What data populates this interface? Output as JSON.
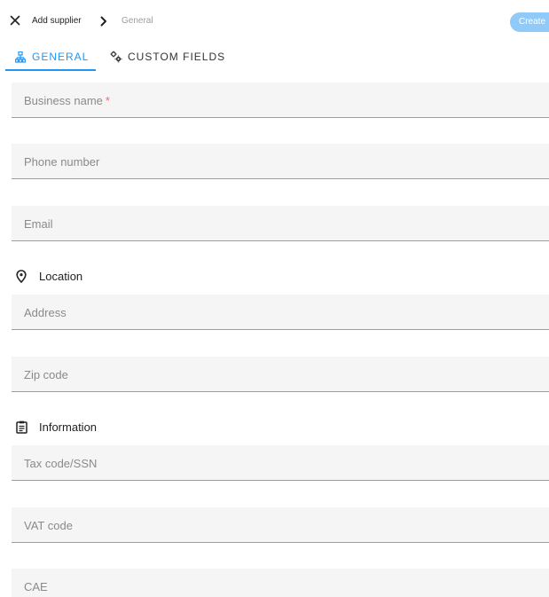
{
  "header": {
    "breadcrumb": [
      "Add supplier",
      "General"
    ],
    "create_label": "Create"
  },
  "tabs": [
    {
      "label": "GENERAL",
      "icon": "sitemap-icon",
      "active": true
    },
    {
      "label": "CUSTOM FIELDS",
      "icon": "cogs-icon",
      "active": false
    }
  ],
  "form": {
    "business_name": {
      "placeholder": "Business name",
      "required_mark": "*"
    },
    "phone_number": {
      "placeholder": "Phone number"
    },
    "email": {
      "placeholder": "Email"
    },
    "location": {
      "title": "Location",
      "icon": "map-pin-icon",
      "address": {
        "placeholder": "Address"
      },
      "zip_code": {
        "placeholder": "Zip code"
      }
    },
    "information": {
      "title": "Information",
      "icon": "clipboard-icon",
      "tax_code": {
        "placeholder": "Tax code/SSN"
      },
      "vat_code": {
        "placeholder": "VAT code"
      },
      "cae": {
        "placeholder": "CAE"
      }
    }
  },
  "colors": {
    "accent": "#2196f3",
    "create_button": "#90caf9",
    "field_bg": "#f5f5f5",
    "required": "#e57373"
  }
}
